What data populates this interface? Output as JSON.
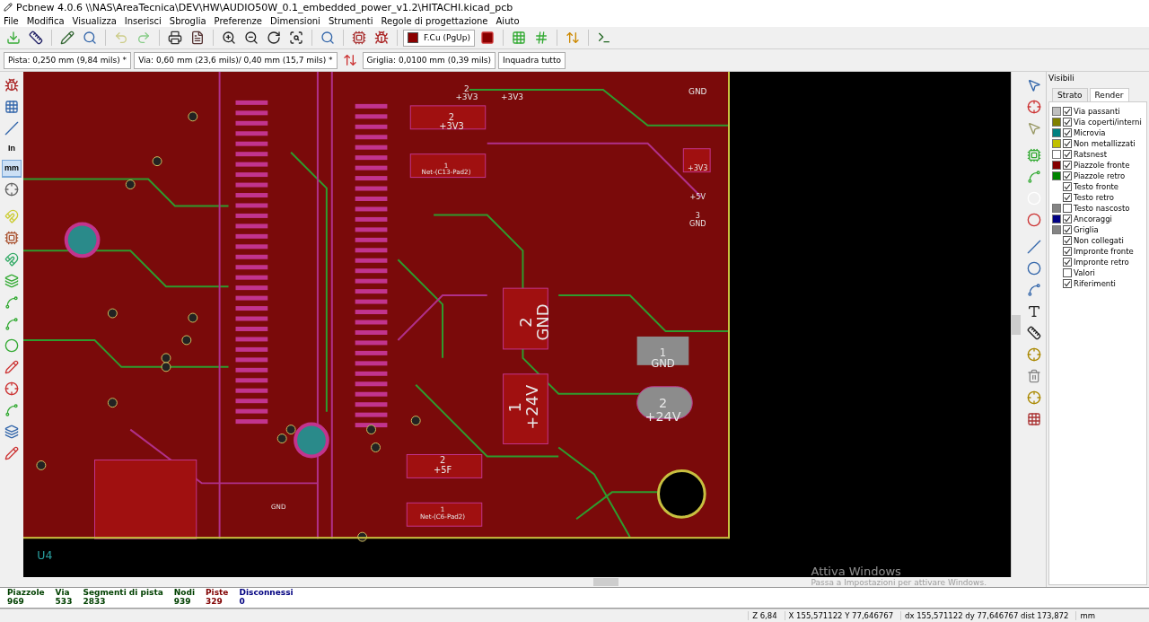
{
  "window": {
    "title": "Pcbnew 4.0.6 \\\\NAS\\AreaTecnica\\DEV\\HW\\AUDIO50W_0.1_embedded_power_v1.2\\HITACHI.kicad_pcb"
  },
  "menu": [
    "File",
    "Modifica",
    "Visualizza",
    "Inserisci",
    "Sbroglia",
    "Preferenze",
    "Dimensioni",
    "Strumenti",
    "Regole di progettazione",
    "Aiuto"
  ],
  "layer_select": {
    "value": "F.Cu (PgUp)",
    "color": "#8b0000"
  },
  "options_bar": {
    "track": "Pista: 0,250 mm (9,84 mils) *",
    "via": "Via: 0,60 mm (23,6 mils)/ 0,40 mm (15,7 mils) *",
    "grid": "Griglia: 0,0100 mm (0,39 mils)",
    "zoom": "Inquadra tutto"
  },
  "unit_buttons": [
    {
      "label": "In",
      "selected": false
    },
    {
      "label": "mm",
      "selected": true
    }
  ],
  "canvas_labels": [
    {
      "num": "2",
      "net": "+3V3"
    },
    {
      "net": "+3V3"
    },
    {
      "net": "GND"
    },
    {
      "num": "2",
      "net": "+3V3"
    },
    {
      "num": "1",
      "net": "Net-(C13-Pad2)"
    },
    {
      "net": "+3V3"
    },
    {
      "net": "+5V"
    },
    {
      "num": "3",
      "net": "GND"
    },
    {
      "num": "2",
      "net": "GND"
    },
    {
      "num": "1",
      "net": "GND"
    },
    {
      "num": "1",
      "net": "+24V"
    },
    {
      "num": "2",
      "net": "+24V"
    },
    {
      "num": "2",
      "net": "+5F"
    },
    {
      "num": "1",
      "net": "Net-(C6-Pad2)"
    },
    {
      "net": "GND"
    },
    {
      "net": "U4"
    }
  ],
  "visible_panel": {
    "title": "Visibili",
    "tabs": [
      {
        "label": "Strato",
        "selected": false
      },
      {
        "label": "Render",
        "selected": true
      }
    ],
    "items": [
      {
        "label": "Via passanti",
        "checked": true,
        "color": "#c0c0c0"
      },
      {
        "label": "Via coperti/interni",
        "checked": true,
        "color": "#808000"
      },
      {
        "label": "Microvia",
        "checked": true,
        "color": "#008080"
      },
      {
        "label": "Non metallizzati",
        "checked": true,
        "color": "#c0c000"
      },
      {
        "label": "Ratsnest",
        "checked": true,
        "color": "#ffffff"
      },
      {
        "label": "Piazzole fronte",
        "checked": true,
        "color": "#840000"
      },
      {
        "label": "Piazzole retro",
        "checked": true,
        "color": "#008400"
      },
      {
        "label": "Testo fronte",
        "checked": true
      },
      {
        "label": "Testo retro",
        "checked": true
      },
      {
        "label": "Testo nascosto",
        "checked": false,
        "color": "#848484"
      },
      {
        "label": "Ancoraggi",
        "checked": true,
        "color": "#000084"
      },
      {
        "label": "Griglia",
        "checked": true,
        "color": "#848484"
      },
      {
        "label": "Non collegati",
        "checked": true
      },
      {
        "label": "Impronte fronte",
        "checked": true
      },
      {
        "label": "Impronte retro",
        "checked": true
      },
      {
        "label": "Valori",
        "checked": false
      },
      {
        "label": "Riferimenti",
        "checked": true
      }
    ]
  },
  "stats": [
    {
      "label": "Piazzole",
      "value": "969",
      "color": "#004000"
    },
    {
      "label": "Via",
      "value": "533",
      "color": "#004000"
    },
    {
      "label": "Segmenti di pista",
      "value": "2833",
      "color": "#004000"
    },
    {
      "label": "Nodi",
      "value": "939",
      "color": "#004000"
    },
    {
      "label": "Piste",
      "value": "329",
      "color": "#800000"
    },
    {
      "label": "Disconnessi",
      "value": "0",
      "color": "#000080"
    }
  ],
  "status_bar": {
    "zoom": "Z 6,84",
    "position": "X 155,571122  Y 77,646767",
    "delta": "dx 155,571122  dy 77,646767  dist 173,872",
    "units": "mm"
  },
  "activation_notice": {
    "title": "Attiva Windows",
    "text": "Passa a Impostazioni per attivare Windows."
  }
}
